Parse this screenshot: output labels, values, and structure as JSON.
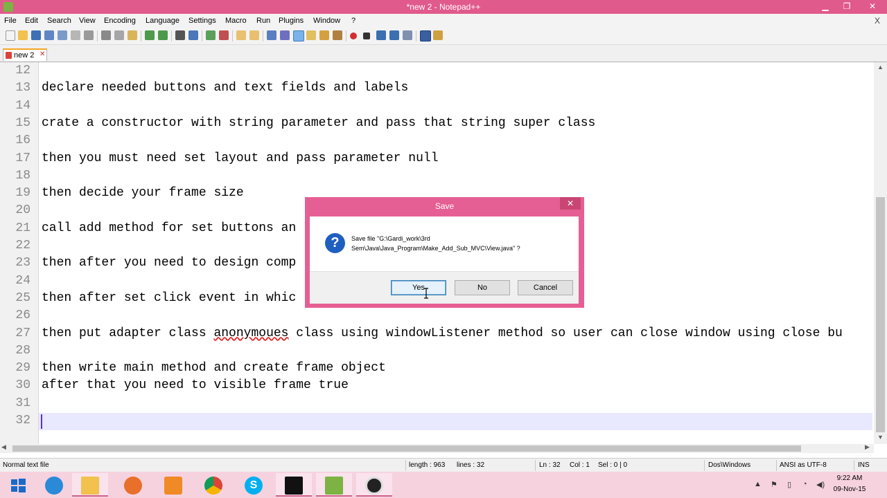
{
  "window": {
    "title": "*new  2 - Notepad++",
    "minimize": "▁",
    "restore": "❐",
    "close": "✕"
  },
  "menu": [
    "File",
    "Edit",
    "Search",
    "View",
    "Encoding",
    "Language",
    "Settings",
    "Macro",
    "Run",
    "Plugins",
    "Window",
    "?"
  ],
  "menu_close": "X",
  "tab": {
    "label": "new  2",
    "close": "✕"
  },
  "editor": {
    "lines": [
      {
        "n": "12",
        "text": ""
      },
      {
        "n": "13",
        "text": "declare needed buttons and text fields and labels"
      },
      {
        "n": "14",
        "text": ""
      },
      {
        "n": "15",
        "text": "crate a constructor with string parameter and pass that string super class"
      },
      {
        "n": "16",
        "text": ""
      },
      {
        "n": "17",
        "text": "then you must need set layout and pass parameter null"
      },
      {
        "n": "18",
        "text": ""
      },
      {
        "n": "19",
        "text": "then decide your frame size"
      },
      {
        "n": "20",
        "text": ""
      },
      {
        "n": "21",
        "text": "call add method for set buttons an"
      },
      {
        "n": "22",
        "text": ""
      },
      {
        "n": "23",
        "text": "then after you need to design comp"
      },
      {
        "n": "24",
        "text": ""
      },
      {
        "n": "25",
        "text": "then after set click event in whic"
      },
      {
        "n": "26",
        "text": ""
      },
      {
        "n": "27",
        "text": "then put adapter class anonymoues class using windowListener method so user can close window using close bu"
      },
      {
        "n": "28",
        "text": ""
      },
      {
        "n": "29",
        "text": "then write main method and create frame object"
      },
      {
        "n": "30",
        "text": "after that you need to visible frame true"
      },
      {
        "n": "31",
        "text": ""
      },
      {
        "n": "32",
        "text": ""
      }
    ],
    "misspelled_word": "anonymoues"
  },
  "dialog": {
    "title": "Save",
    "close": "✕",
    "icon": "question-icon",
    "icon_glyph": "?",
    "message_line1": "Save file \"G:\\Gardi_work\\3rd",
    "message_line2": "Sem\\Java\\Java_Program\\Make_Add_Sub_MVC\\View.java\" ?",
    "buttons": {
      "yes": "Yes",
      "no": "No",
      "cancel": "Cancel"
    }
  },
  "status": {
    "file_type": "Normal text file",
    "length": "length : 963",
    "lines": "lines : 32",
    "ln": "Ln : 32",
    "col": "Col : 1",
    "sel": "Sel : 0 | 0",
    "eol": "Dos\\Windows",
    "encoding": "ANSI as UTF-8",
    "mode": "INS"
  },
  "taskbar": {
    "apps": [
      "start-icon",
      "internet-explorer-icon",
      "file-explorer-icon",
      "firefox-icon",
      "photo-app-icon",
      "chrome-icon",
      "skype-icon",
      "command-prompt-icon",
      "notepad-plus-plus-icon",
      "screen-recorder-icon"
    ],
    "time": "9:22 AM",
    "date": "09-Nov-15"
  },
  "colors": {
    "accent": "#e15a8c",
    "taskbar": "#f6d2df",
    "current_line": "#e8e8ff"
  }
}
